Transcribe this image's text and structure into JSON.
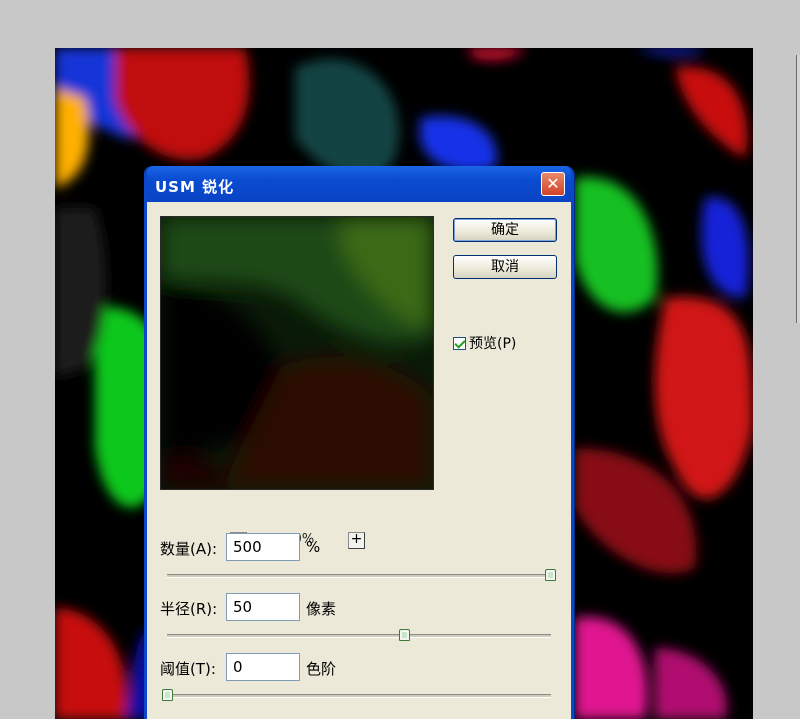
{
  "dialog": {
    "title": "USM 锐化",
    "close_glyph": "✕",
    "ok_label": "确定",
    "cancel_label": "取消",
    "preview_label": "预览(P)",
    "preview_checked": true,
    "zoom_out_glyph": "-",
    "zoom_in_glyph": "+",
    "zoom_level": "100%",
    "amount": {
      "label": "数量(A):",
      "value": "500",
      "unit": "%",
      "slider_fraction": 1.0
    },
    "radius": {
      "label": "半径(R):",
      "value": "50",
      "unit": "像素",
      "slider_fraction": 0.62
    },
    "threshold": {
      "label": "阈值(T):",
      "value": "0",
      "unit": "色阶",
      "slider_fraction": 0.0
    }
  },
  "colors": {
    "titlebar": "#0a4bd0",
    "dialog_face": "#ece9d8",
    "close_button": "#d0432a"
  }
}
